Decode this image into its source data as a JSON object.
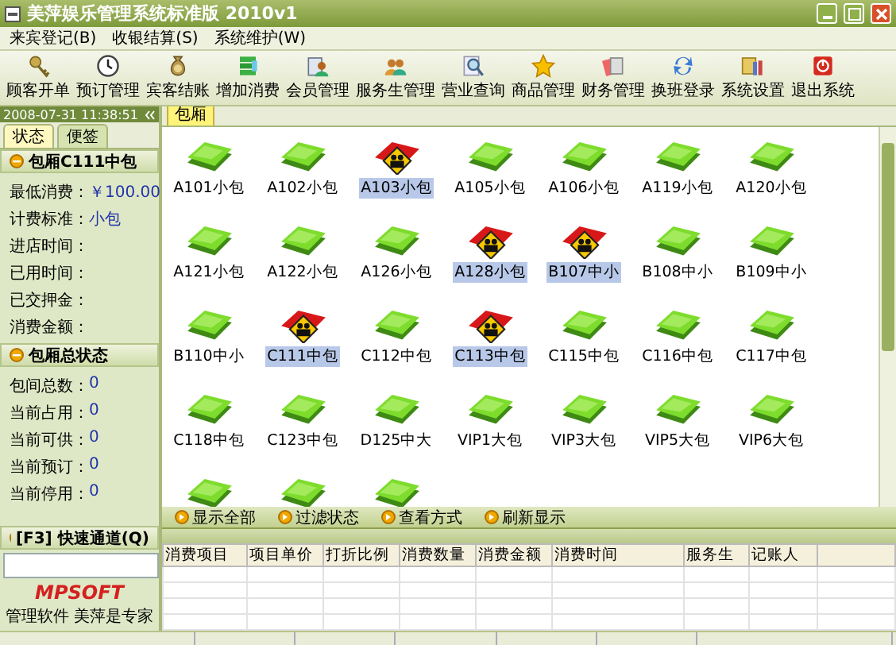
{
  "window": {
    "title": "美萍娱乐管理系统标准版 2010v1"
  },
  "menu": [
    "来宾登记(B)",
    "收银结算(S)",
    "系统维护(W)"
  ],
  "toolbar": [
    "顾客开单",
    "预订管理",
    "宾客结账",
    "增加消费",
    "会员管理",
    "服务生管理",
    "营业查询",
    "商品管理",
    "财务管理",
    "换班登录",
    "系统设置",
    "退出系统"
  ],
  "clock": "2008-07-31 11:38:51",
  "side_tabs": [
    {
      "label": "状态",
      "selected": true
    },
    {
      "label": "便签",
      "selected": false
    }
  ],
  "room_panel": {
    "title": "包厢C111中包",
    "fields": [
      {
        "label": "最低消费：",
        "value": "￥100.00"
      },
      {
        "label": "计费标准：",
        "value": "小包"
      },
      {
        "label": "进店时间："
      },
      {
        "label": "已用时间："
      },
      {
        "label": "已交押金："
      },
      {
        "label": "消费金额："
      }
    ]
  },
  "summary_panel": {
    "title": "包厢总状态",
    "fields": [
      {
        "label": "包间总数：",
        "value": "0"
      },
      {
        "label": "当前占用：",
        "value": "0"
      },
      {
        "label": "当前可供：",
        "value": "0"
      },
      {
        "label": "当前预订：",
        "value": "0"
      },
      {
        "label": "当前停用：",
        "value": "0"
      }
    ]
  },
  "quick_panel": {
    "title": "[F3] 快速通道(Q)",
    "logo": "MPSOFT",
    "slogan": "管理软件 美萍是专家"
  },
  "main_tab": "包厢",
  "rooms": [
    {
      "label": "A101小包",
      "occupied": false
    },
    {
      "label": "A102小包",
      "occupied": false
    },
    {
      "label": "A103小包",
      "occupied": true
    },
    {
      "label": "A105小包",
      "occupied": false
    },
    {
      "label": "A106小包",
      "occupied": false
    },
    {
      "label": "A119小包",
      "occupied": false
    },
    {
      "label": "A120小包",
      "occupied": false
    },
    {
      "label": "A121小包",
      "occupied": false
    },
    {
      "label": "A122小包",
      "occupied": false
    },
    {
      "label": "A126小包",
      "occupied": false
    },
    {
      "label": "A128小包",
      "occupied": true
    },
    {
      "label": "B107中小",
      "occupied": true
    },
    {
      "label": "B108中小",
      "occupied": false
    },
    {
      "label": "B109中小",
      "occupied": false
    },
    {
      "label": "B110中小",
      "occupied": false
    },
    {
      "label": "C111中包",
      "occupied": true
    },
    {
      "label": "C112中包",
      "occupied": false
    },
    {
      "label": "C113中包",
      "occupied": true
    },
    {
      "label": "C115中包",
      "occupied": false
    },
    {
      "label": "C116中包",
      "occupied": false
    },
    {
      "label": "C117中包",
      "occupied": false
    },
    {
      "label": "C118中包",
      "occupied": false
    },
    {
      "label": "C123中包",
      "occupied": false
    },
    {
      "label": "D125中大",
      "occupied": false
    },
    {
      "label": "VIP1大包",
      "occupied": false
    },
    {
      "label": "VIP3大包",
      "occupied": false
    },
    {
      "label": "VIP5大包",
      "occupied": false
    },
    {
      "label": "VIP6大包",
      "occupied": false
    },
    {
      "occupied": false
    },
    {
      "occupied": false
    },
    {
      "occupied": false
    }
  ],
  "actions": [
    "显示全部",
    "过滤状态",
    "查看方式",
    "刷新显示"
  ],
  "table": {
    "columns": [
      "消费项目",
      "项目单价",
      "打折比例",
      "消费数量",
      "消费金额",
      "消费时间",
      "服务生",
      "记账人"
    ]
  }
}
